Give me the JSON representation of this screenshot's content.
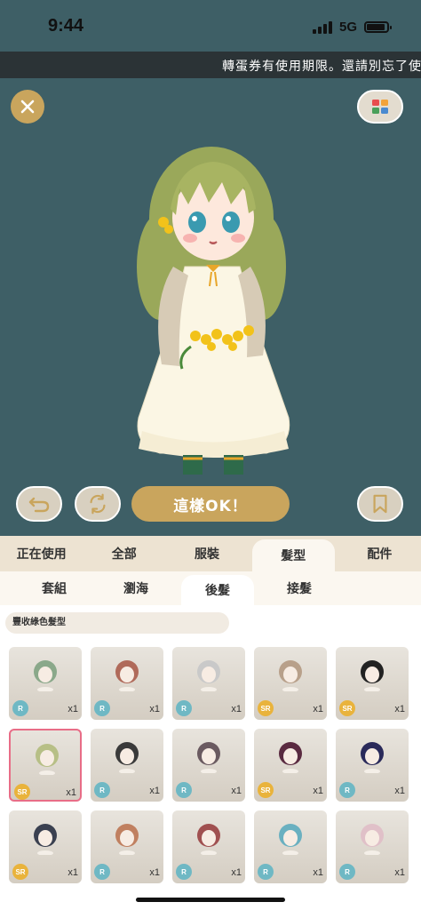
{
  "status": {
    "time": "9:44",
    "network": "5G"
  },
  "notice": "轉蛋券有使用期限。還請別忘了使",
  "actions": {
    "ok_label": "這樣OK！"
  },
  "category_tabs": [
    {
      "label": "正在使用",
      "active": false
    },
    {
      "label": "全部",
      "active": false
    },
    {
      "label": "服裝",
      "active": false
    },
    {
      "label": "髮型",
      "active": true
    },
    {
      "label": "配件",
      "active": false
    }
  ],
  "sub_tabs": [
    {
      "label": "套組",
      "active": false
    },
    {
      "label": "瀏海",
      "active": false
    },
    {
      "label": "後髮",
      "active": true
    },
    {
      "label": "接髮",
      "active": false
    }
  ],
  "filter": {
    "label": "豐收綠色髮型"
  },
  "colors": {
    "accent": "#c9a55d",
    "background": "#3e5f66",
    "selected": "#e86d87"
  },
  "items": [
    {
      "rarity": "R",
      "count": "x1",
      "hair": "#8aa88a"
    },
    {
      "rarity": "R",
      "count": "x1",
      "hair": "#b06a5a"
    },
    {
      "rarity": "R",
      "count": "x1",
      "hair": "#c9c9c9"
    },
    {
      "rarity": "SR",
      "count": "x1",
      "hair": "#b8a08a"
    },
    {
      "rarity": "SR",
      "count": "x1",
      "hair": "#222222"
    },
    {
      "rarity": "SR",
      "count": "x1",
      "hair": "#b7bf86",
      "selected": true
    },
    {
      "rarity": "R",
      "count": "x1",
      "hair": "#3a3a3a"
    },
    {
      "rarity": "R",
      "count": "x1",
      "hair": "#6a5a60"
    },
    {
      "rarity": "SR",
      "count": "x1",
      "hair": "#5a2a40"
    },
    {
      "rarity": "R",
      "count": "x1",
      "hair": "#2a2a5a"
    },
    {
      "rarity": "SR",
      "count": "x1",
      "hair": "#3a4050"
    },
    {
      "rarity": "R",
      "count": "x1",
      "hair": "#c08060"
    },
    {
      "rarity": "R",
      "count": "x1",
      "hair": "#a05050"
    },
    {
      "rarity": "R",
      "count": "x1",
      "hair": "#6ab0c0"
    },
    {
      "rarity": "R",
      "count": "x1",
      "hair": "#e0c0c8"
    }
  ]
}
